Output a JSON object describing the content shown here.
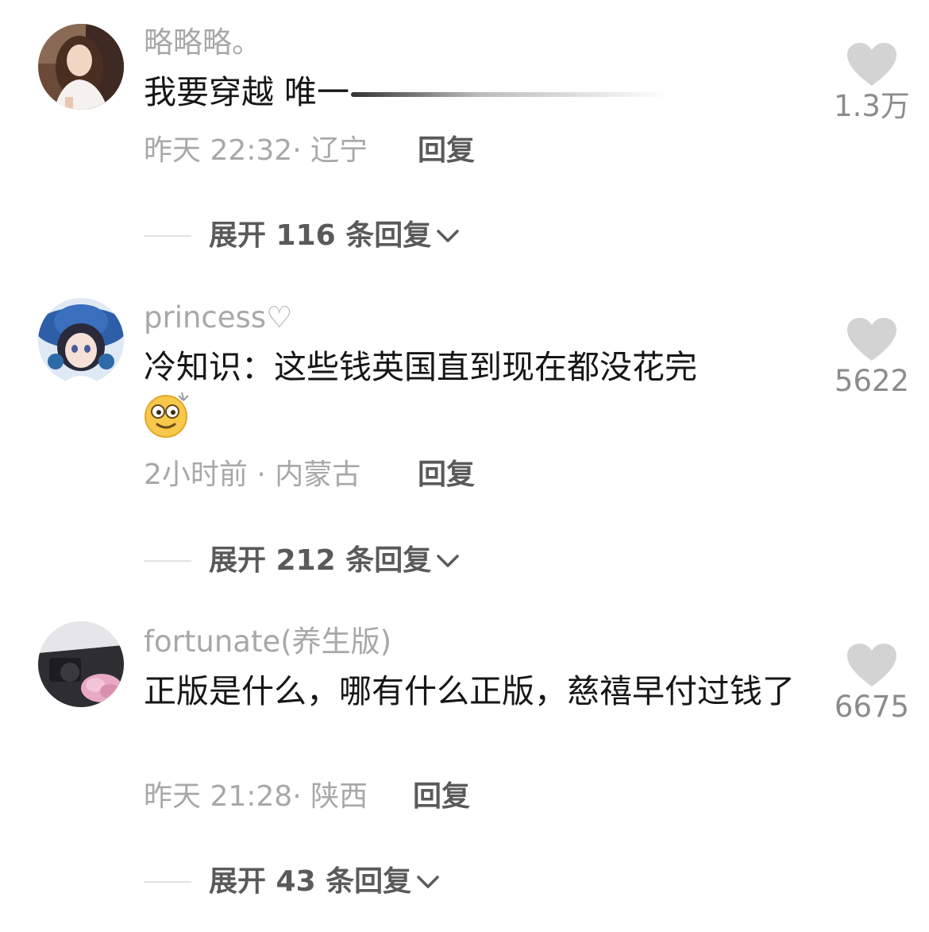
{
  "comments": [
    {
      "username": "略略略。",
      "text": "我要穿越 唯一",
      "time_location": "昨天 22:32· 辽宁",
      "reply_label": "回复",
      "likes": "1.3万",
      "expand_label": "展开 116 条回复"
    },
    {
      "username": "princess♡",
      "text": "冷知识：这些钱英国直到现在都没花完",
      "emoji": "dizzy-face-emoji",
      "time_location": "2小时前 · 内蒙古",
      "reply_label": "回复",
      "likes": "5622",
      "expand_label": "展开 212 条回复"
    },
    {
      "username": "fortunate(养生版)",
      "text": "正版是什么，哪有什么正版，慈禧早付过钱了",
      "time_location": "昨天 21:28· 陕西",
      "reply_label": "回复",
      "likes": "6675",
      "expand_label": "展开 43 条回复"
    }
  ],
  "icons": {
    "like": "heart-icon",
    "expand": "chevron-down-icon"
  },
  "colors": {
    "heart": "#d3d3d3",
    "muted_text": "#a8a8a8",
    "body_text": "#161616",
    "action_text": "#5a5a5a"
  }
}
